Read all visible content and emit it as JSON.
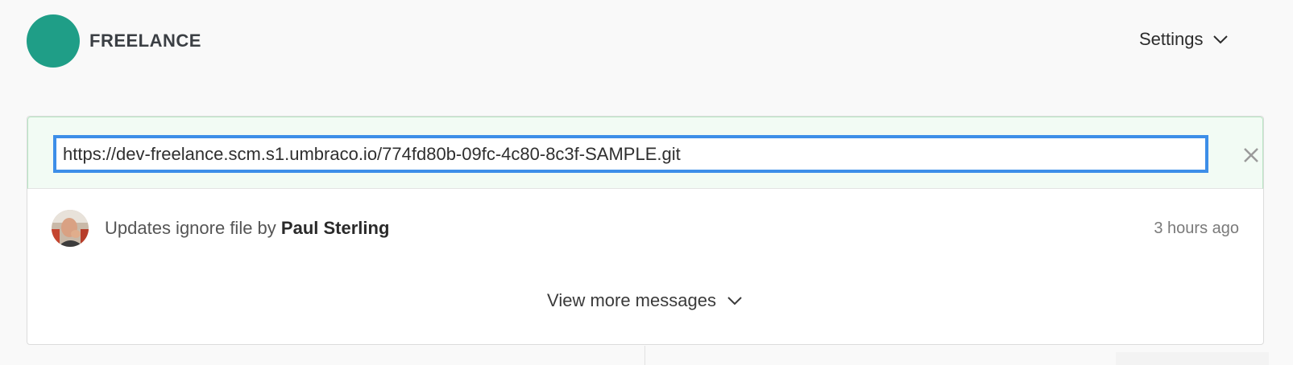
{
  "header": {
    "project_name": "FREELANCE",
    "logo_color": "#1f9e87",
    "settings_label": "Settings"
  },
  "clone": {
    "url_value": "https://dev-freelance.scm.s1.umbraco.io/774fd80b-09fc-4c80-8c3f-SAMPLE.git",
    "close_icon": "close-icon"
  },
  "commit": {
    "message_prefix": "Updates ignore file by",
    "author": "Paul Sterling",
    "time": "3 hours ago"
  },
  "view_more_label": "View more messages",
  "colors": {
    "accent_blue": "#3d8ee8",
    "success_border": "#b9e6c4",
    "success_bg": "#f2fbf4"
  }
}
